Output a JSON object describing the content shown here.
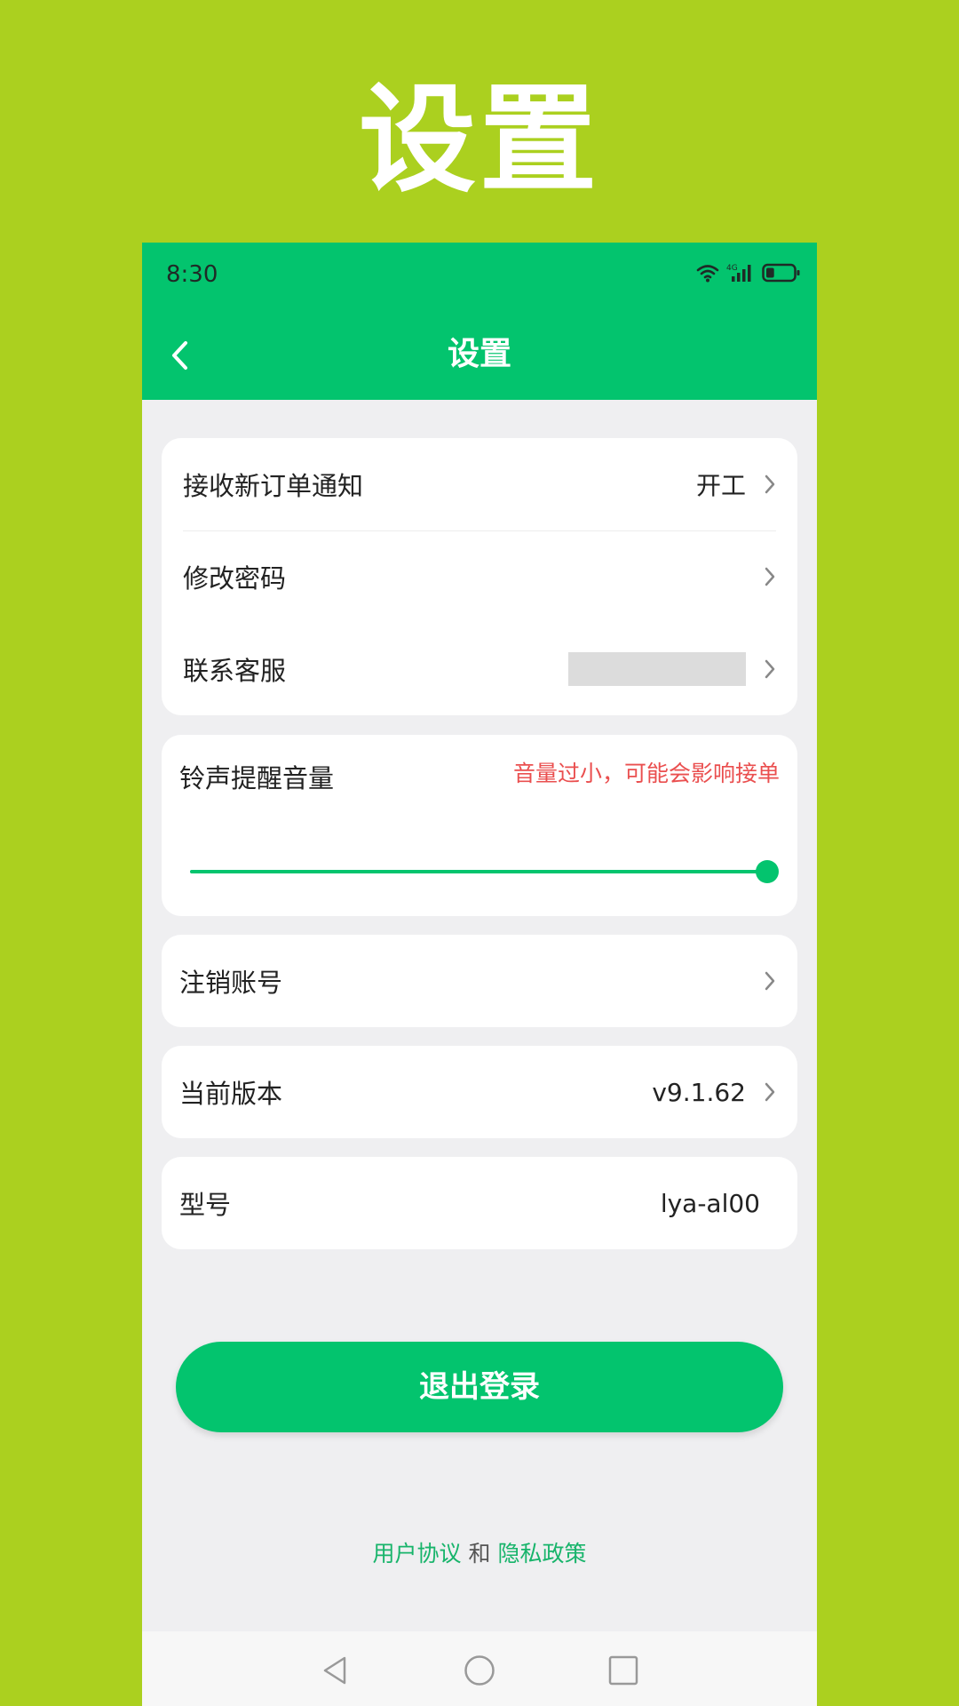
{
  "promo": {
    "title": "设置"
  },
  "status_bar": {
    "time": "8:30",
    "network": "4G",
    "battery_level": 0.3
  },
  "header": {
    "title": "设置"
  },
  "settings_group": {
    "new_order_notice": {
      "label": "接收新订单通知",
      "value": "开工"
    },
    "change_password": {
      "label": "修改密码"
    },
    "contact_service": {
      "label": "联系客服"
    }
  },
  "volume": {
    "label": "铃声提醒音量",
    "warning": "音量过小，可能会影响接单",
    "level": 1.0
  },
  "cancel_account": {
    "label": "注销账号"
  },
  "version": {
    "label": "当前版本",
    "value": "v9.1.62"
  },
  "model": {
    "label": "型号",
    "value": "lya-al00"
  },
  "logout": {
    "label": "退出登录"
  },
  "footer": {
    "user_agreement": "用户协议",
    "and": "和",
    "privacy_policy": "隐私政策"
  },
  "colors": {
    "page_background": "#abd01f",
    "brand_green": "#03c46e",
    "warning_red": "#ea4f4f",
    "app_background": "#efeff1"
  }
}
